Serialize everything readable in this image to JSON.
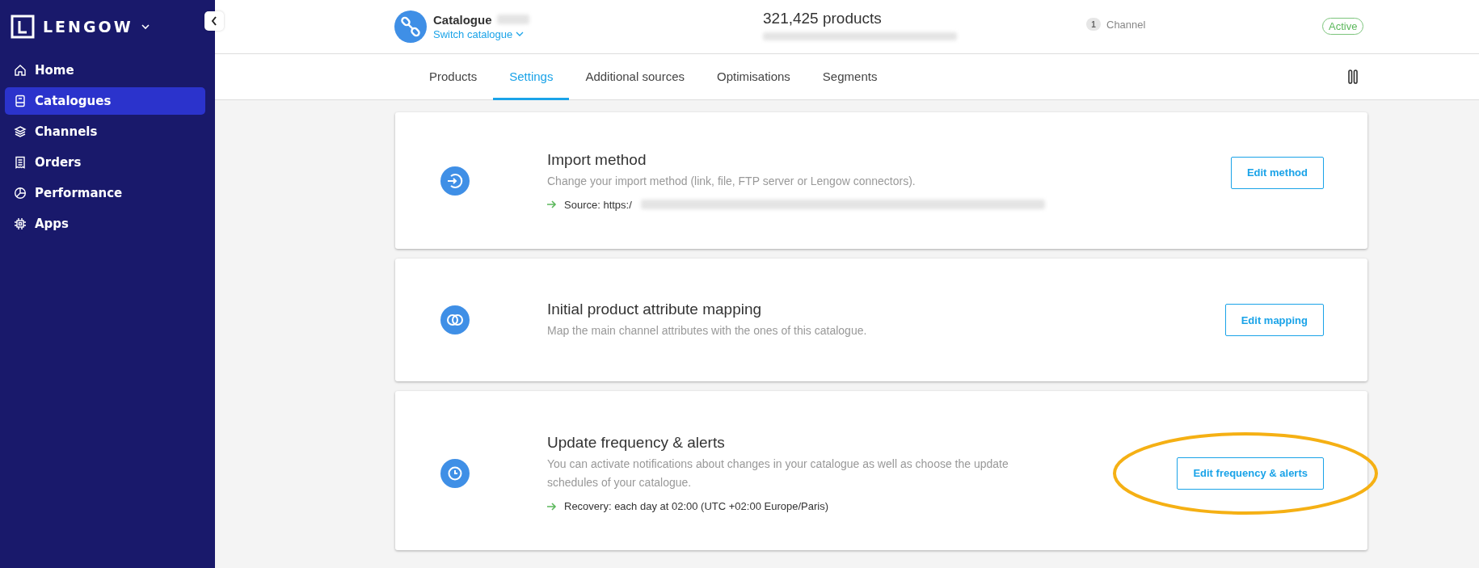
{
  "sidebar": {
    "brand": "LENGOW",
    "items": [
      {
        "label": "Home",
        "kind": "home",
        "selected": false
      },
      {
        "label": "Catalogues",
        "kind": "book",
        "selected": true
      },
      {
        "label": "Channels",
        "kind": "layers",
        "selected": false
      },
      {
        "label": "Orders",
        "kind": "receipt",
        "selected": false
      },
      {
        "label": "Performance",
        "kind": "pie",
        "selected": false
      },
      {
        "label": "Apps",
        "kind": "chip",
        "selected": false
      }
    ]
  },
  "header": {
    "catalogue_label": "Catalogue",
    "switch_link": "Switch catalogue",
    "products": "321,425 products",
    "channel_count": "1",
    "channel_label": "Channel",
    "status": "Active"
  },
  "tabs": [
    {
      "label": "Products",
      "selected": false
    },
    {
      "label": "Settings",
      "selected": true
    },
    {
      "label": "Additional sources",
      "selected": false
    },
    {
      "label": "Optimisations",
      "selected": false
    },
    {
      "label": "Segments",
      "selected": false
    }
  ],
  "cards": [
    {
      "kind": "import",
      "title": "Import method",
      "description": "Change your import method (link, file, FTP server or Lengow connectors).",
      "detail": "Source: https:/",
      "detail_redacted": true,
      "button": "Edit method",
      "highlighted": false
    },
    {
      "kind": "rings",
      "title": "Initial product attribute mapping",
      "description": "Map the main channel attributes with the ones of this catalogue.",
      "button": "Edit mapping",
      "highlighted": false
    },
    {
      "kind": "clock",
      "title": "Update frequency & alerts",
      "description": "You can activate notifications about changes in your catalogue as well as choose the update schedules of your catalogue.",
      "detail": "Recovery: each day at 02:00 (UTC +02:00 Europe/Paris)",
      "detail_redacted": false,
      "button": "Edit frequency & alerts",
      "highlighted": true
    }
  ]
}
